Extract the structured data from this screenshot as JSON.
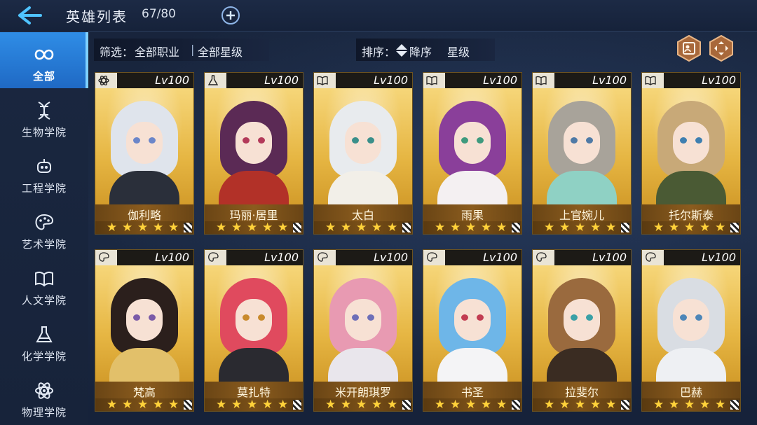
{
  "header": {
    "title": "英雄列表",
    "count": "67/80"
  },
  "sidebar": {
    "items": [
      {
        "label": "全部",
        "icon": "infinity-icon",
        "active": true
      },
      {
        "label": "生物学院",
        "icon": "dna-icon",
        "active": false
      },
      {
        "label": "工程学院",
        "icon": "robot-icon",
        "active": false
      },
      {
        "label": "艺术学院",
        "icon": "palette-icon",
        "active": false
      },
      {
        "label": "人文学院",
        "icon": "book-icon",
        "active": false
      },
      {
        "label": "化学学院",
        "icon": "flask-icon",
        "active": false
      },
      {
        "label": "物理学院",
        "icon": "atom-icon",
        "active": false
      }
    ]
  },
  "filter": {
    "label": "筛选：",
    "class_value": "全部职业",
    "star_value": "全部星级"
  },
  "sort": {
    "label": "排序：",
    "order": "降序",
    "field": "星级"
  },
  "colors": {
    "accent_blue": "#2f8de6",
    "card_gold": "#e6b643",
    "star": "#ffd23a"
  },
  "heroes": [
    {
      "name": "伽利略",
      "level": "Lv100",
      "class_icon": "atom-icon",
      "stars": 5
    },
    {
      "name": "玛丽·居里",
      "level": "Lv100",
      "class_icon": "flask-icon",
      "stars": 5
    },
    {
      "name": "太白",
      "level": "Lv100",
      "class_icon": "book-icon",
      "stars": 5
    },
    {
      "name": "雨果",
      "level": "Lv100",
      "class_icon": "book-icon",
      "stars": 5
    },
    {
      "name": "上官婉儿",
      "level": "Lv100",
      "class_icon": "book-icon",
      "stars": 5
    },
    {
      "name": "托尔斯泰",
      "level": "Lv100",
      "class_icon": "book-icon",
      "stars": 5
    },
    {
      "name": "梵高",
      "level": "Lv100",
      "class_icon": "palette-icon",
      "stars": 5
    },
    {
      "name": "莫扎特",
      "level": "Lv100",
      "class_icon": "palette-icon",
      "stars": 5
    },
    {
      "name": "米开朗琪罗",
      "level": "Lv100",
      "class_icon": "palette-icon",
      "stars": 5
    },
    {
      "name": "书圣",
      "level": "Lv100",
      "class_icon": "palette-icon",
      "stars": 5
    },
    {
      "name": "拉斐尔",
      "level": "Lv100",
      "class_icon": "palette-icon",
      "stars": 5
    },
    {
      "name": "巴赫",
      "level": "Lv100",
      "class_icon": "palette-icon",
      "stars": 5
    }
  ]
}
